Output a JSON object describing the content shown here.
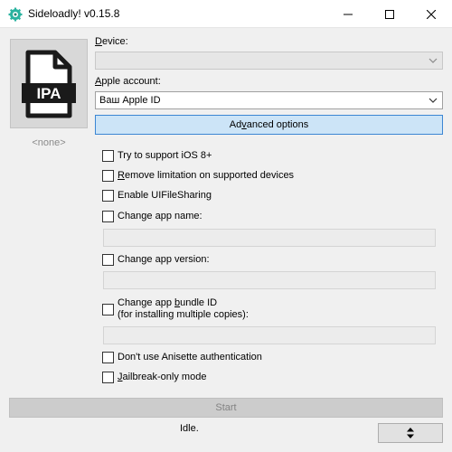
{
  "window": {
    "title": "Sideloadly! v0.15.8",
    "icon": "gear-icon"
  },
  "file": {
    "icon_label": "IPA",
    "name": "<none>"
  },
  "device": {
    "label_accel": "D",
    "label_rest": "evice:",
    "value": ""
  },
  "account": {
    "label_accel": "A",
    "label_rest": "pple account:",
    "value": "Ваш Apple ID"
  },
  "advanced": {
    "pre": "Ad",
    "accel": "v",
    "post": "anced options"
  },
  "options": {
    "ios8": {
      "label": "Try to support iOS 8+",
      "checked": false
    },
    "remove_limit": {
      "accel": "R",
      "rest": "emove limitation on supported devices",
      "checked": false
    },
    "file_sharing": {
      "label": "Enable UIFileSharing",
      "checked": false
    },
    "app_name": {
      "label": "Change app name:",
      "checked": false,
      "value": ""
    },
    "app_version": {
      "label": "Change app version:",
      "checked": false,
      "value": ""
    },
    "bundle_id": {
      "line1_pre": "Change app ",
      "line1_accel": "b",
      "line1_post": "undle ID",
      "line2": "(for installing multiple copies):",
      "checked": false,
      "value": ""
    },
    "anisette": {
      "label": "Don't use Anisette authentication",
      "checked": false
    },
    "jailbreak": {
      "accel": "J",
      "rest": "ailbreak-only mode",
      "checked": false
    }
  },
  "start": {
    "label": "Start"
  },
  "status": {
    "text": "Idle."
  },
  "sort_button": {
    "icon": "sort-arrows-icon"
  }
}
